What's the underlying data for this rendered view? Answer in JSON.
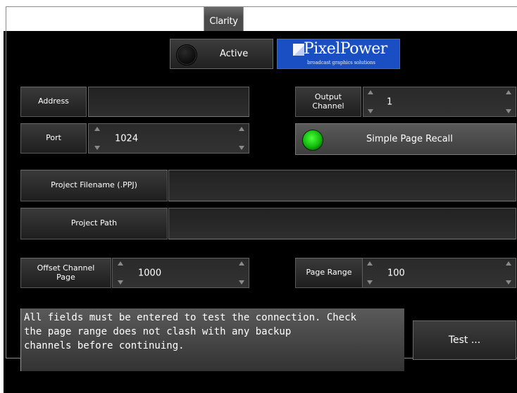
{
  "tab": {
    "label": "Clarity"
  },
  "status": {
    "active_label": "Active"
  },
  "logo": {
    "name": "PixelPower",
    "tagline": "broadcast graphics solutions"
  },
  "address": {
    "label": "Address",
    "value": ""
  },
  "output_channel": {
    "label_line1": "Output",
    "label_line2": "Channel",
    "value": "1"
  },
  "port": {
    "label": "Port",
    "value": "1024"
  },
  "simple_page_recall": {
    "label": "Simple Page Recall"
  },
  "project_filename": {
    "label": "Project Filename (.PPJ)",
    "value": ""
  },
  "project_path": {
    "label": "Project Path",
    "value": ""
  },
  "offset_channel_page": {
    "label_line1": "Offset Channel",
    "label_line2": "Page",
    "value": "1000"
  },
  "page_range": {
    "label": "Page Range",
    "value": "100"
  },
  "message": {
    "line1": "All fields must be entered to test the connection. Check",
    "line2": "the page range does not clash with any backup",
    "line3": "channels before continuing."
  },
  "test_button": {
    "label": "Test ..."
  },
  "colors": {
    "panel_bg": "#000000",
    "logo_blue": "#1a4fc4",
    "led_green": "#22cc18"
  },
  "icons": {
    "active_led": "led-off-icon",
    "recall_led": "led-on-icon"
  }
}
